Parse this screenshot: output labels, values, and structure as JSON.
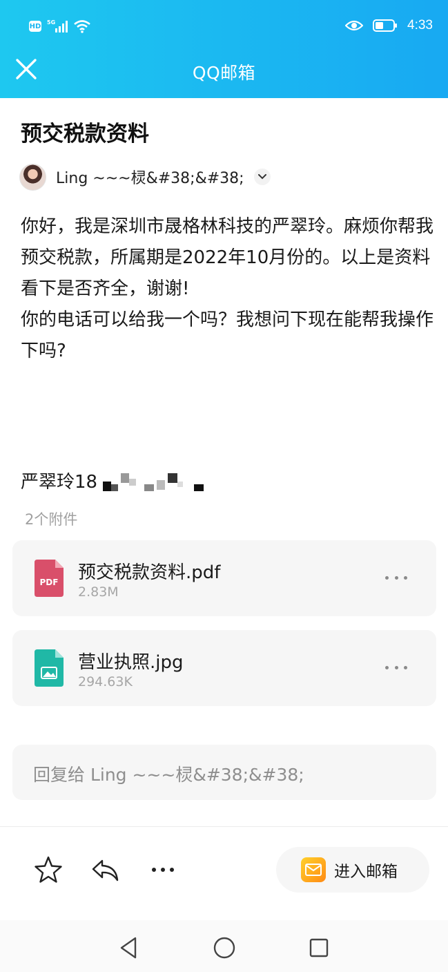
{
  "status_bar": {
    "network_badge": "HD",
    "network_type": "5G",
    "icons": [
      "signal-icon",
      "wifi-icon",
      "eye-icon",
      "battery-icon"
    ],
    "time": "4:33"
  },
  "app_bar": {
    "title": "QQ邮箱",
    "close_icon": "close-icon"
  },
  "email": {
    "subject": "预交税款资料",
    "sender": "Ling ~~~棂&#38;&#38;",
    "body": [
      "你好，我是深圳市晟格林科技的严翠玲。麻烦你帮我预交税款，所属期是2022年10月份的。以上是资料看下是否齐全，谢谢!",
      "你的电话可以给我一个吗？我想问下现在能帮我操作下吗?"
    ],
    "signature": "严翠玲18"
  },
  "attachments": {
    "count_label": "2个附件",
    "items": [
      {
        "name": "预交税款资料.pdf",
        "size": "2.83M",
        "type": "pdf",
        "icon_label": "PDF",
        "color": "#d94f6a"
      },
      {
        "name": "营业执照.jpg",
        "size": "294.63K",
        "type": "image",
        "color": "#20b8a6"
      }
    ]
  },
  "reply": {
    "placeholder": "回复给 Ling ~~~棂&#38;&#38;"
  },
  "toolbar": {
    "star_icon": "star-icon",
    "reply_icon": "reply-icon",
    "more_icon": "more-icon",
    "enter_mailbox": "进入邮箱"
  },
  "nav": [
    "back-icon",
    "home-icon",
    "recents-icon"
  ],
  "colors": {
    "header_start": "#1ec8f0",
    "header_end": "#18a9f2",
    "pdf": "#d94f6a",
    "image": "#20b8a6"
  }
}
